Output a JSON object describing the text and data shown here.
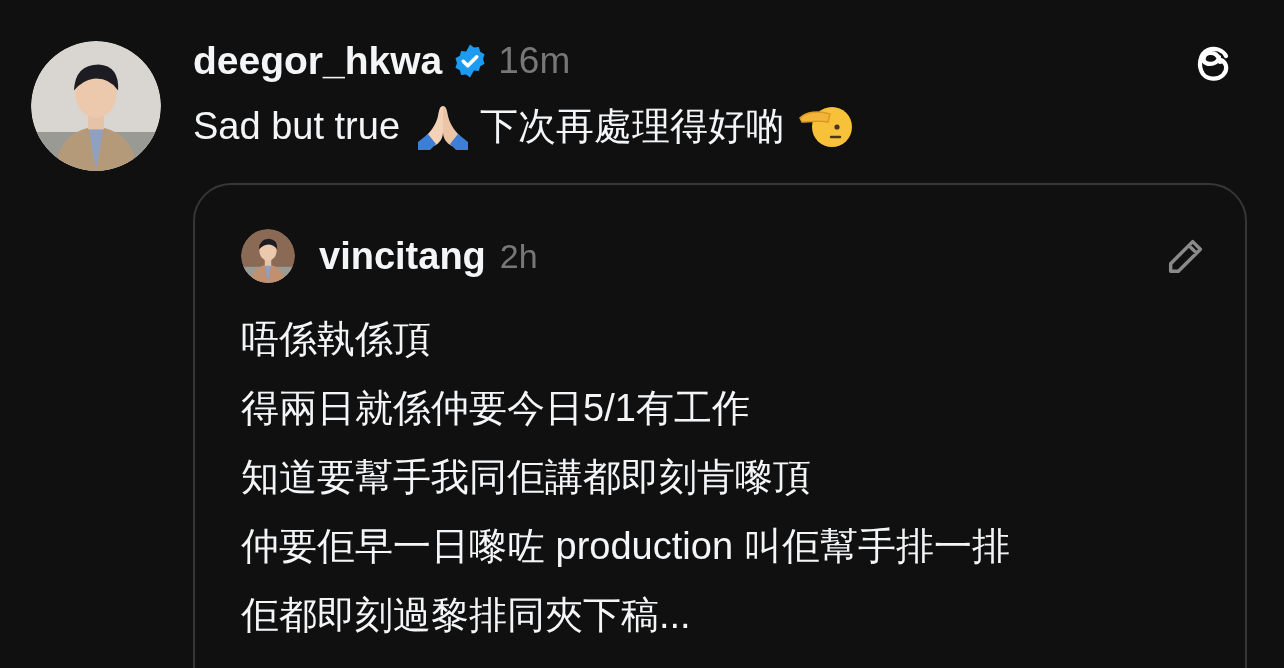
{
  "post": {
    "username": "deegor_hkwa",
    "verified": true,
    "time": "16m",
    "content": [
      {
        "kind": "text",
        "text": "Sad but true"
      },
      {
        "kind": "hands"
      },
      {
        "kind": "text",
        "text": "下次再處理得好啲"
      },
      {
        "kind": "salute"
      }
    ],
    "quote": {
      "username": "vincitang",
      "time": "2h",
      "lines": [
        "唔係執係頂",
        "得兩日就係仲要今日5/1有工作",
        "知道要幫手我同佢講都即刻肯嚟頂",
        "仲要佢早一日嚟咗 production 叫佢幫手排一排",
        "佢都即刻過黎排同夾下稿..."
      ]
    }
  }
}
